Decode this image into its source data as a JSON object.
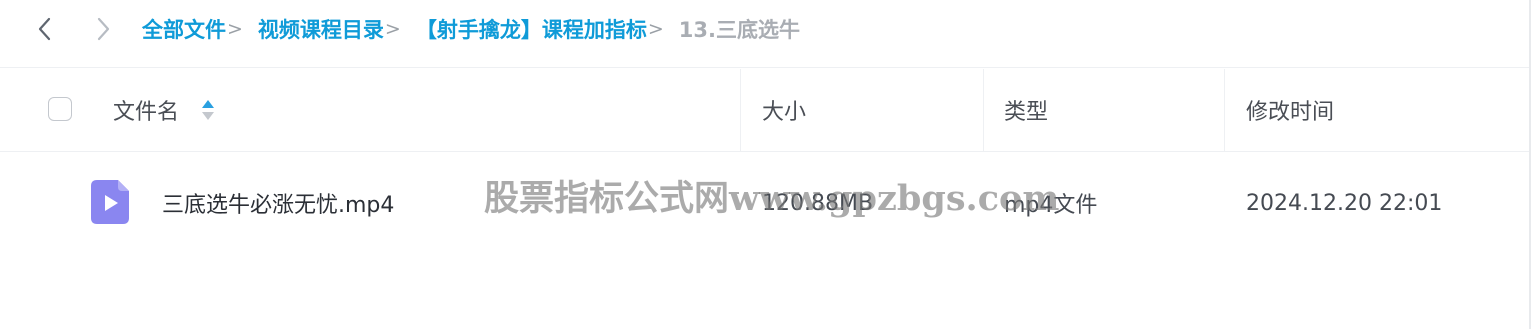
{
  "nav": {
    "back_icon": "chevron-left-icon",
    "forward_icon": "chevron-right-icon"
  },
  "breadcrumb": {
    "items": [
      "全部文件",
      "视频课程目录",
      "【射手擒龙】课程加指标"
    ],
    "current": "13.三底选牛",
    "separator": ">",
    "link_color": "#0f9bd8",
    "current_color": "#a9adb3"
  },
  "table": {
    "columns": {
      "name": "文件名",
      "size": "大小",
      "type": "类型",
      "modified": "修改时间"
    },
    "sort_icon": "sort-up-down-icon",
    "rows": [
      {
        "icon": "video-file-icon",
        "name": "三底选牛必涨无忧.mp4",
        "size": "120.88MB",
        "type": "mp4文件",
        "modified": "2024.12.20 22:01"
      }
    ]
  },
  "watermark": "股票指标公式网www.gpzbgs.com",
  "colors": {
    "video_icon": "#8a86f0",
    "sort_active": "#2aa0e0"
  }
}
